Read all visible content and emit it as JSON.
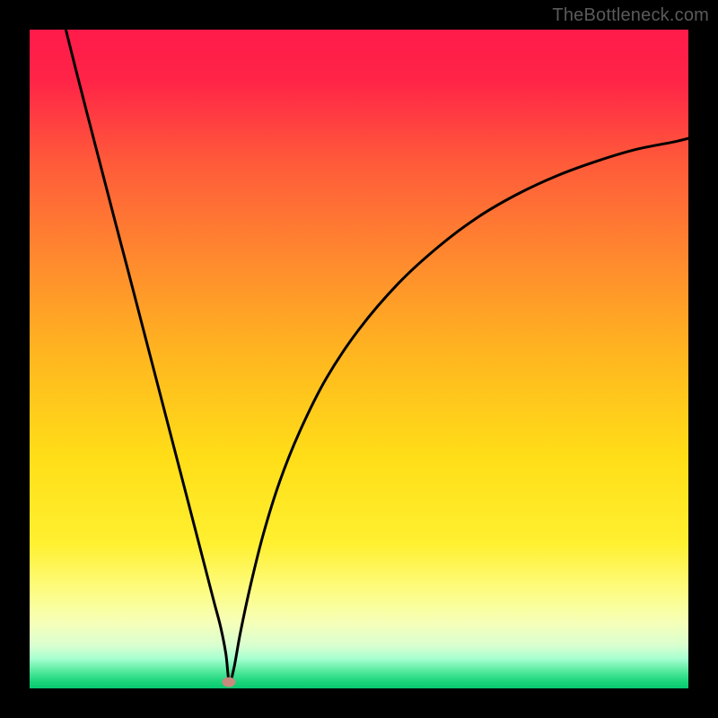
{
  "watermark": "TheBottleneck.com",
  "chart_data": {
    "type": "line",
    "title": "",
    "xlabel": "",
    "ylabel": "",
    "xlim": [
      0,
      100
    ],
    "ylim": [
      0,
      100
    ],
    "grid": false,
    "background_gradient": [
      {
        "pos": 0.0,
        "color": "#ff1a4a"
      },
      {
        "pos": 0.08,
        "color": "#ff2547"
      },
      {
        "pos": 0.2,
        "color": "#ff5a3a"
      },
      {
        "pos": 0.35,
        "color": "#ff8a2e"
      },
      {
        "pos": 0.5,
        "color": "#ffb81f"
      },
      {
        "pos": 0.65,
        "color": "#ffde18"
      },
      {
        "pos": 0.78,
        "color": "#fff030"
      },
      {
        "pos": 0.85,
        "color": "#fdfc80"
      },
      {
        "pos": 0.9,
        "color": "#f6ffb8"
      },
      {
        "pos": 0.935,
        "color": "#d9ffd0"
      },
      {
        "pos": 0.955,
        "color": "#a6ffd0"
      },
      {
        "pos": 0.975,
        "color": "#4fe89a"
      },
      {
        "pos": 0.99,
        "color": "#1ad47a"
      },
      {
        "pos": 1.0,
        "color": "#08c86f"
      }
    ],
    "series": [
      {
        "name": "bottleneck-curve",
        "color": "#000000",
        "x": [
          5.5,
          7,
          9,
          11,
          13,
          15,
          17,
          19,
          21,
          23,
          25,
          26.5,
          28,
          29,
          29.8,
          30.3,
          31,
          32,
          33.5,
          35.5,
          38,
          41,
          45,
          50,
          56,
          62,
          68,
          74,
          80,
          86,
          92,
          98,
          100
        ],
        "y": [
          100,
          94,
          86.2,
          78.5,
          70.8,
          63.2,
          55.5,
          47.8,
          40.1,
          32.4,
          24.7,
          18.9,
          13.1,
          9.3,
          5.2,
          1.0,
          3.0,
          8.5,
          15.5,
          23.5,
          31.5,
          39.0,
          47.0,
          54.5,
          61.5,
          67.0,
          71.5,
          75.0,
          77.8,
          80.0,
          81.8,
          83.0,
          83.5
        ]
      }
    ],
    "marker": {
      "x": 30.3,
      "y": 1.0,
      "color": "#c78a7d"
    }
  }
}
